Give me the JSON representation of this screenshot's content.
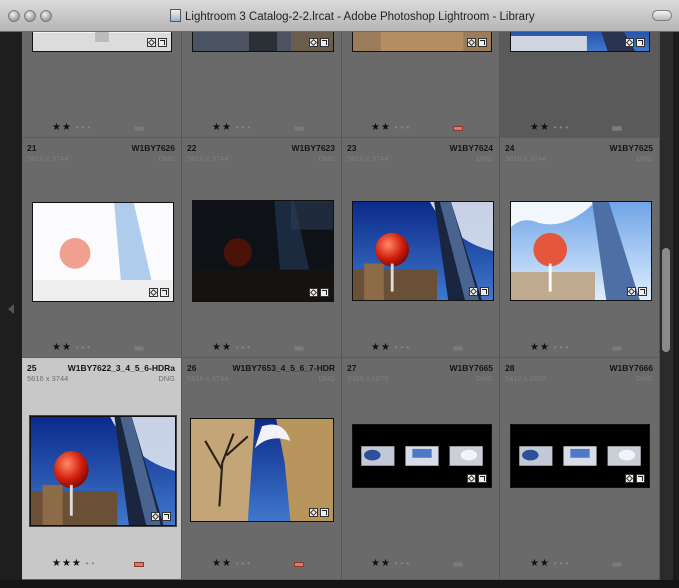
{
  "window": {
    "title": "Lightroom 3 Catalog-2-2.lrcat - Adobe Photoshop Lightroom - Library",
    "file_icon": "lightroom-catalog-icon"
  },
  "grid": {
    "rows": [
      {
        "cells": [
          {
            "index": "",
            "filename": "",
            "dimensions": "",
            "filetype": "",
            "rating": 2,
            "color_label": "",
            "thumb_kind": "bright"
          },
          {
            "index": "",
            "filename": "",
            "dimensions": "",
            "filetype": "",
            "rating": 2,
            "color_label": "",
            "thumb_kind": "street"
          },
          {
            "index": "",
            "filename": "",
            "dimensions": "",
            "filetype": "",
            "rating": 2,
            "color_label": "red",
            "thumb_kind": "building"
          },
          {
            "index": "",
            "filename": "",
            "dimensions": "",
            "filetype": "",
            "rating": 2,
            "color_label": "",
            "thumb_kind": "redball"
          }
        ]
      },
      {
        "cells": [
          {
            "index": "21",
            "filename": "W1BY7626",
            "dimensions": "5616 x 3744",
            "filetype": "DNG",
            "rating": 2,
            "color_label": "",
            "thumb_kind": "overexposed"
          },
          {
            "index": "22",
            "filename": "W1BY7623",
            "dimensions": "5616 x 3744",
            "filetype": "DNG",
            "rating": 2,
            "color_label": "",
            "thumb_kind": "underexposed"
          },
          {
            "index": "23",
            "filename": "W1BY7624",
            "dimensions": "5616 x 3744",
            "filetype": "DNG",
            "rating": 2,
            "color_label": "",
            "thumb_kind": "normal"
          },
          {
            "index": "24",
            "filename": "W1BY7625",
            "dimensions": "5616 x 3744",
            "filetype": "DNG",
            "rating": 2,
            "color_label": "",
            "thumb_kind": "bright-sky"
          }
        ]
      },
      {
        "cells": [
          {
            "index": "25",
            "filename": "W1BY7622_3_4_5_6-HDRa",
            "dimensions": "5616 x 3744",
            "filetype": "DNG",
            "rating": 3,
            "color_label": "red",
            "thumb_kind": "hdr"
          },
          {
            "index": "26",
            "filename": "W1BY7653_4_5_6_7-HDR",
            "dimensions": "5616 x 3744",
            "filetype": "DNG",
            "rating": 2,
            "color_label": "red",
            "thumb_kind": "tree-building"
          },
          {
            "index": "27",
            "filename": "W1BY7665",
            "dimensions": "3389 x 1079",
            "filetype": "DNG",
            "rating": 2,
            "color_label": "",
            "thumb_kind": "panel"
          },
          {
            "index": "28",
            "filename": "W1BY7666",
            "dimensions": "5412 x 2852",
            "filetype": "DNG",
            "rating": 2,
            "color_label": "",
            "thumb_kind": "panel"
          }
        ]
      }
    ]
  },
  "colors": {
    "grid_background": "#525252",
    "cell": "#6a6a6a",
    "selected_cell": "#c8c8c8",
    "label_red": "#d97a6a"
  },
  "icons": {
    "badge_keyword": "keyword-tag-icon",
    "badge_edit": "develop-adjusted-icon",
    "window_buttons": [
      "close-icon",
      "minimize-icon",
      "zoom-icon"
    ]
  }
}
